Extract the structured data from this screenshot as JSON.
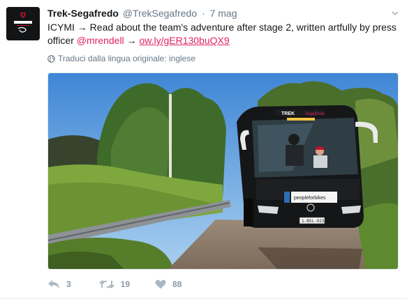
{
  "tweet": {
    "display_name": "Trek-Segafredo",
    "screen_name": "@TrekSegafredo",
    "separator": "·",
    "timestamp": "7 mag",
    "text_part1": "ICYMI → Read about the team's adventure after stage 2, written artfully by press officer ",
    "mention": "@mrendell",
    "arrow": " → ",
    "url": "ow.ly/gER130buQX9",
    "translate_label": "Traduci dalla lingua originale: inglese"
  },
  "media": {
    "bus_brand": "TREK",
    "bus_sponsor": "Segafredo",
    "bus_panel": "peopleforbikes",
    "license_plate": "1-BSL-023",
    "icon": "photo"
  },
  "actions": {
    "reply_count": "3",
    "retweet_count": "19",
    "like_count": "88"
  },
  "icons": {
    "caret": "chevron-down-icon",
    "globe": "globe-icon",
    "reply": "reply-icon",
    "retweet": "retweet-icon",
    "like": "heart-icon"
  },
  "colors": {
    "link": "#e0245e",
    "muted": "#657786",
    "action": "#aab8c2"
  }
}
